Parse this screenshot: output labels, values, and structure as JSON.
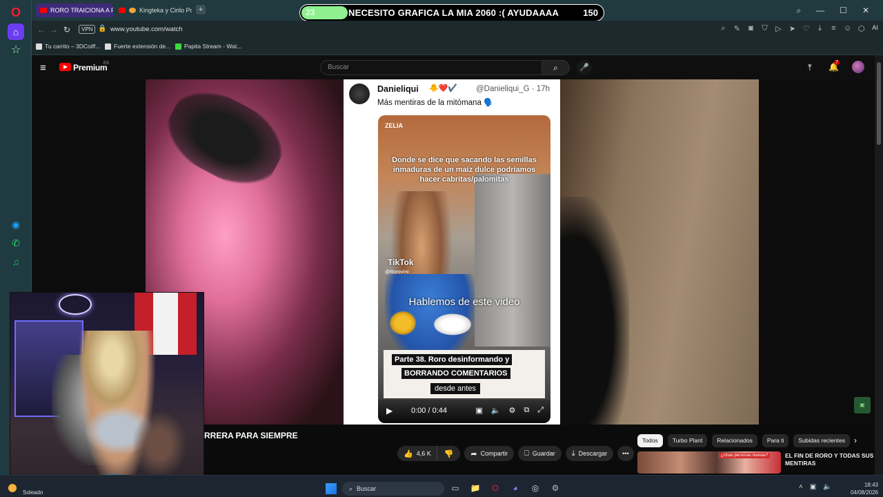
{
  "browser": {
    "tabs": [
      {
        "label": "RORO TRAICIONA A P",
        "active": true
      },
      {
        "label": "Kingteka y Cirilo Pospo",
        "active": false
      }
    ],
    "new_tab": "+",
    "url": "www.youtube.com/watch",
    "vpn_label": "VPN",
    "ai_label": "AI",
    "bookmarks": [
      "Tu carrito – 3DCoiff...",
      "Fuerte extensión de...",
      "Papita Stream - Wat..."
    ]
  },
  "overlay": {
    "count": "23",
    "title": "NECESITO GRAFICA LA MIA 2060 :( AYUDAAAA",
    "goal": "150",
    "progress_fraction": 0.153,
    "accent": "#8ef08e"
  },
  "youtube": {
    "brand": "Premium",
    "region": "ES",
    "search_placeholder": "Buscar",
    "notifications": "7",
    "video_title": "RRERA PARA SIEMPRE",
    "likes": "4,6 K",
    "share": "Compartir",
    "save": "Guardar",
    "download": "Descargar",
    "more": "•••",
    "chips": [
      "Todos",
      "Turbo Plant",
      "Relacionados",
      "Para ti",
      "Subidas recientes"
    ],
    "recommendation_title": "EL FIN DE RORO Y TODAS SUS MENTIRAS",
    "recommendation_badge": "¿Unas personas nuevas?",
    "accent": "#ff0000"
  },
  "tweet": {
    "name": "Danieliqui",
    "emojis": "🐥❤️✔️",
    "handle": "@Danieliqui_G · 17h",
    "text": "Más mentiras de la mitómana 🗣️",
    "watermark": "ZELIA",
    "caption_top": "Donde se dice que sacando las semillas inmaduras de un maíz dulce podríamos hacer cabritas/palomitas",
    "tiktok": "TikTok",
    "tiktok_user": "@Rorovimi",
    "caption_mid": "Hablemos de este video",
    "banner_line1": "Parte 38. Roro desinformando y",
    "banner_line2": "BORRANDO COMENTARIOS",
    "banner_line3": "desde antes",
    "time": "0:00 / 0:44"
  },
  "taskbar": {
    "weather": "Soleado",
    "search": "Buscar",
    "time": "18:43",
    "date": "04/08/2026"
  }
}
